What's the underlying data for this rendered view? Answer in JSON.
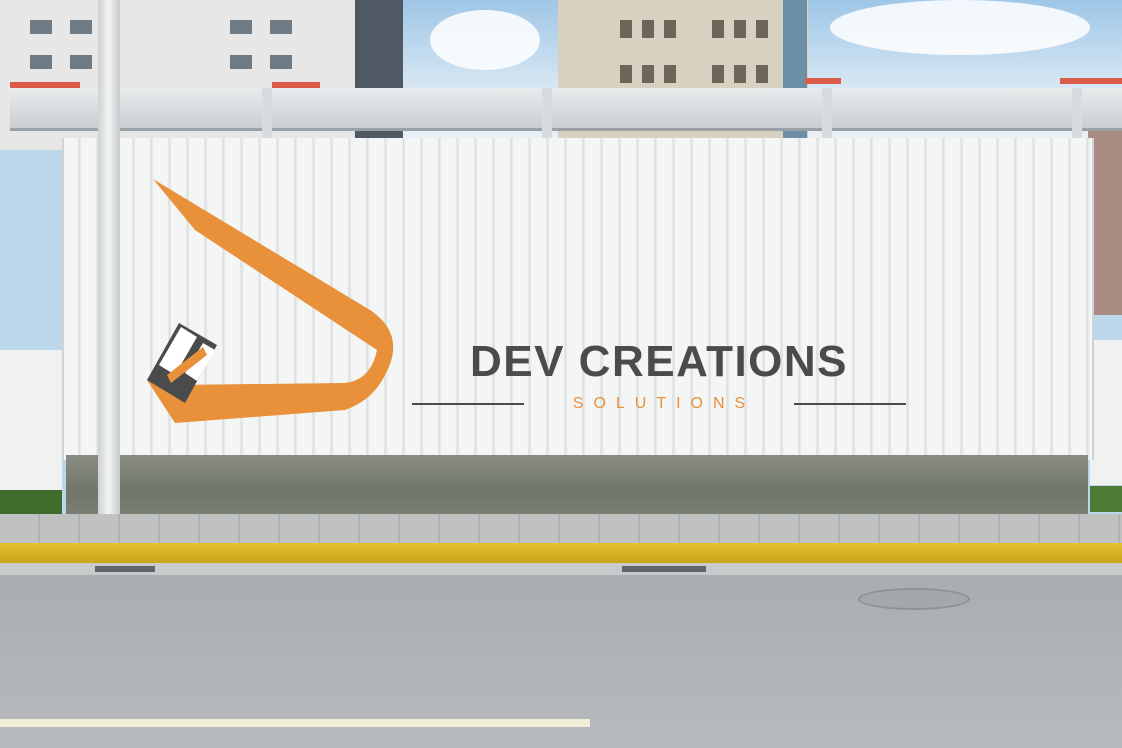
{
  "scene": "billboard-mockup",
  "billboard": {
    "brand_name": "DEV CREATIONS",
    "tagline": "SOLUTIONS"
  },
  "colors": {
    "brand_orange": "#e8903a",
    "brand_gray": "#4a4b4c",
    "curb_yellow": "#e2c12d"
  }
}
